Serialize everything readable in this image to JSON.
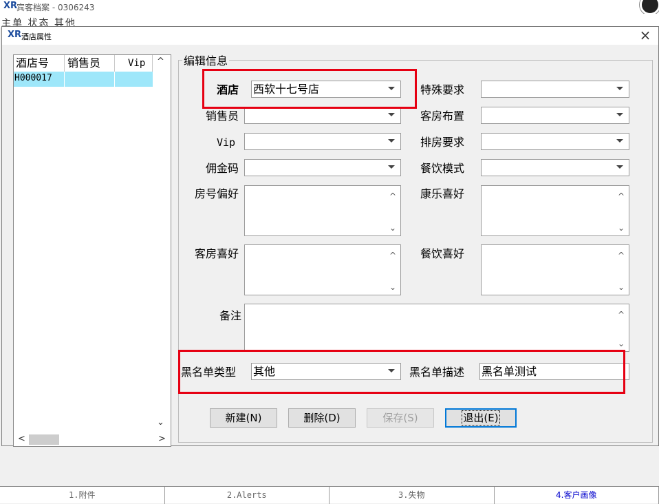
{
  "bg": {
    "logo": "XR",
    "title": "宾客档案 - 0306243",
    "menu": "主单  状态  其他"
  },
  "dialog": {
    "logo": "XR",
    "title": "酒店属性",
    "close": "×"
  },
  "list": {
    "columns": [
      "酒店号",
      "销售员",
      "Vip"
    ],
    "rows": [
      {
        "hotel_no": "H000017",
        "salesman": "",
        "vip": ""
      }
    ],
    "scroll_up": "^",
    "scroll_down": "⌄",
    "scroll_left": "<",
    "scroll_right": ">"
  },
  "form": {
    "legend": "编辑信息",
    "hotel": {
      "label": "酒店",
      "value": "西软十七号店"
    },
    "salesman": {
      "label": "销售员",
      "value": ""
    },
    "vip": {
      "label": "Vip",
      "value": ""
    },
    "commission": {
      "label": "佣金码",
      "value": ""
    },
    "special": {
      "label": "特殊要求",
      "value": ""
    },
    "room_layout": {
      "label": "客房布置",
      "value": ""
    },
    "room_arrange": {
      "label": "排房要求",
      "value": ""
    },
    "dining_mode": {
      "label": "餐饮模式",
      "value": ""
    },
    "room_no_pref": {
      "label": "房号偏好",
      "value": ""
    },
    "recreation_pref": {
      "label": "康乐喜好",
      "value": ""
    },
    "room_pref": {
      "label": "客房喜好",
      "value": ""
    },
    "dining_pref": {
      "label": "餐饮喜好",
      "value": ""
    },
    "remark": {
      "label": "备注",
      "value": ""
    },
    "blacklist_type": {
      "label": "黑名单类型",
      "value": "其他"
    },
    "blacklist_desc": {
      "label": "黑名单描述",
      "value": "黑名单测试"
    }
  },
  "buttons": {
    "new": "新建(N)",
    "delete": "删除(D)",
    "save": "保存(S)",
    "exit": "退出(E)"
  },
  "tabs": [
    "1.附件",
    "2.Alerts",
    "3.失物",
    "4.客户画像"
  ],
  "colors": {
    "highlight_row": "#9ee7fa",
    "annotation_red": "#e60012",
    "active_tab": "#0000cc"
  }
}
